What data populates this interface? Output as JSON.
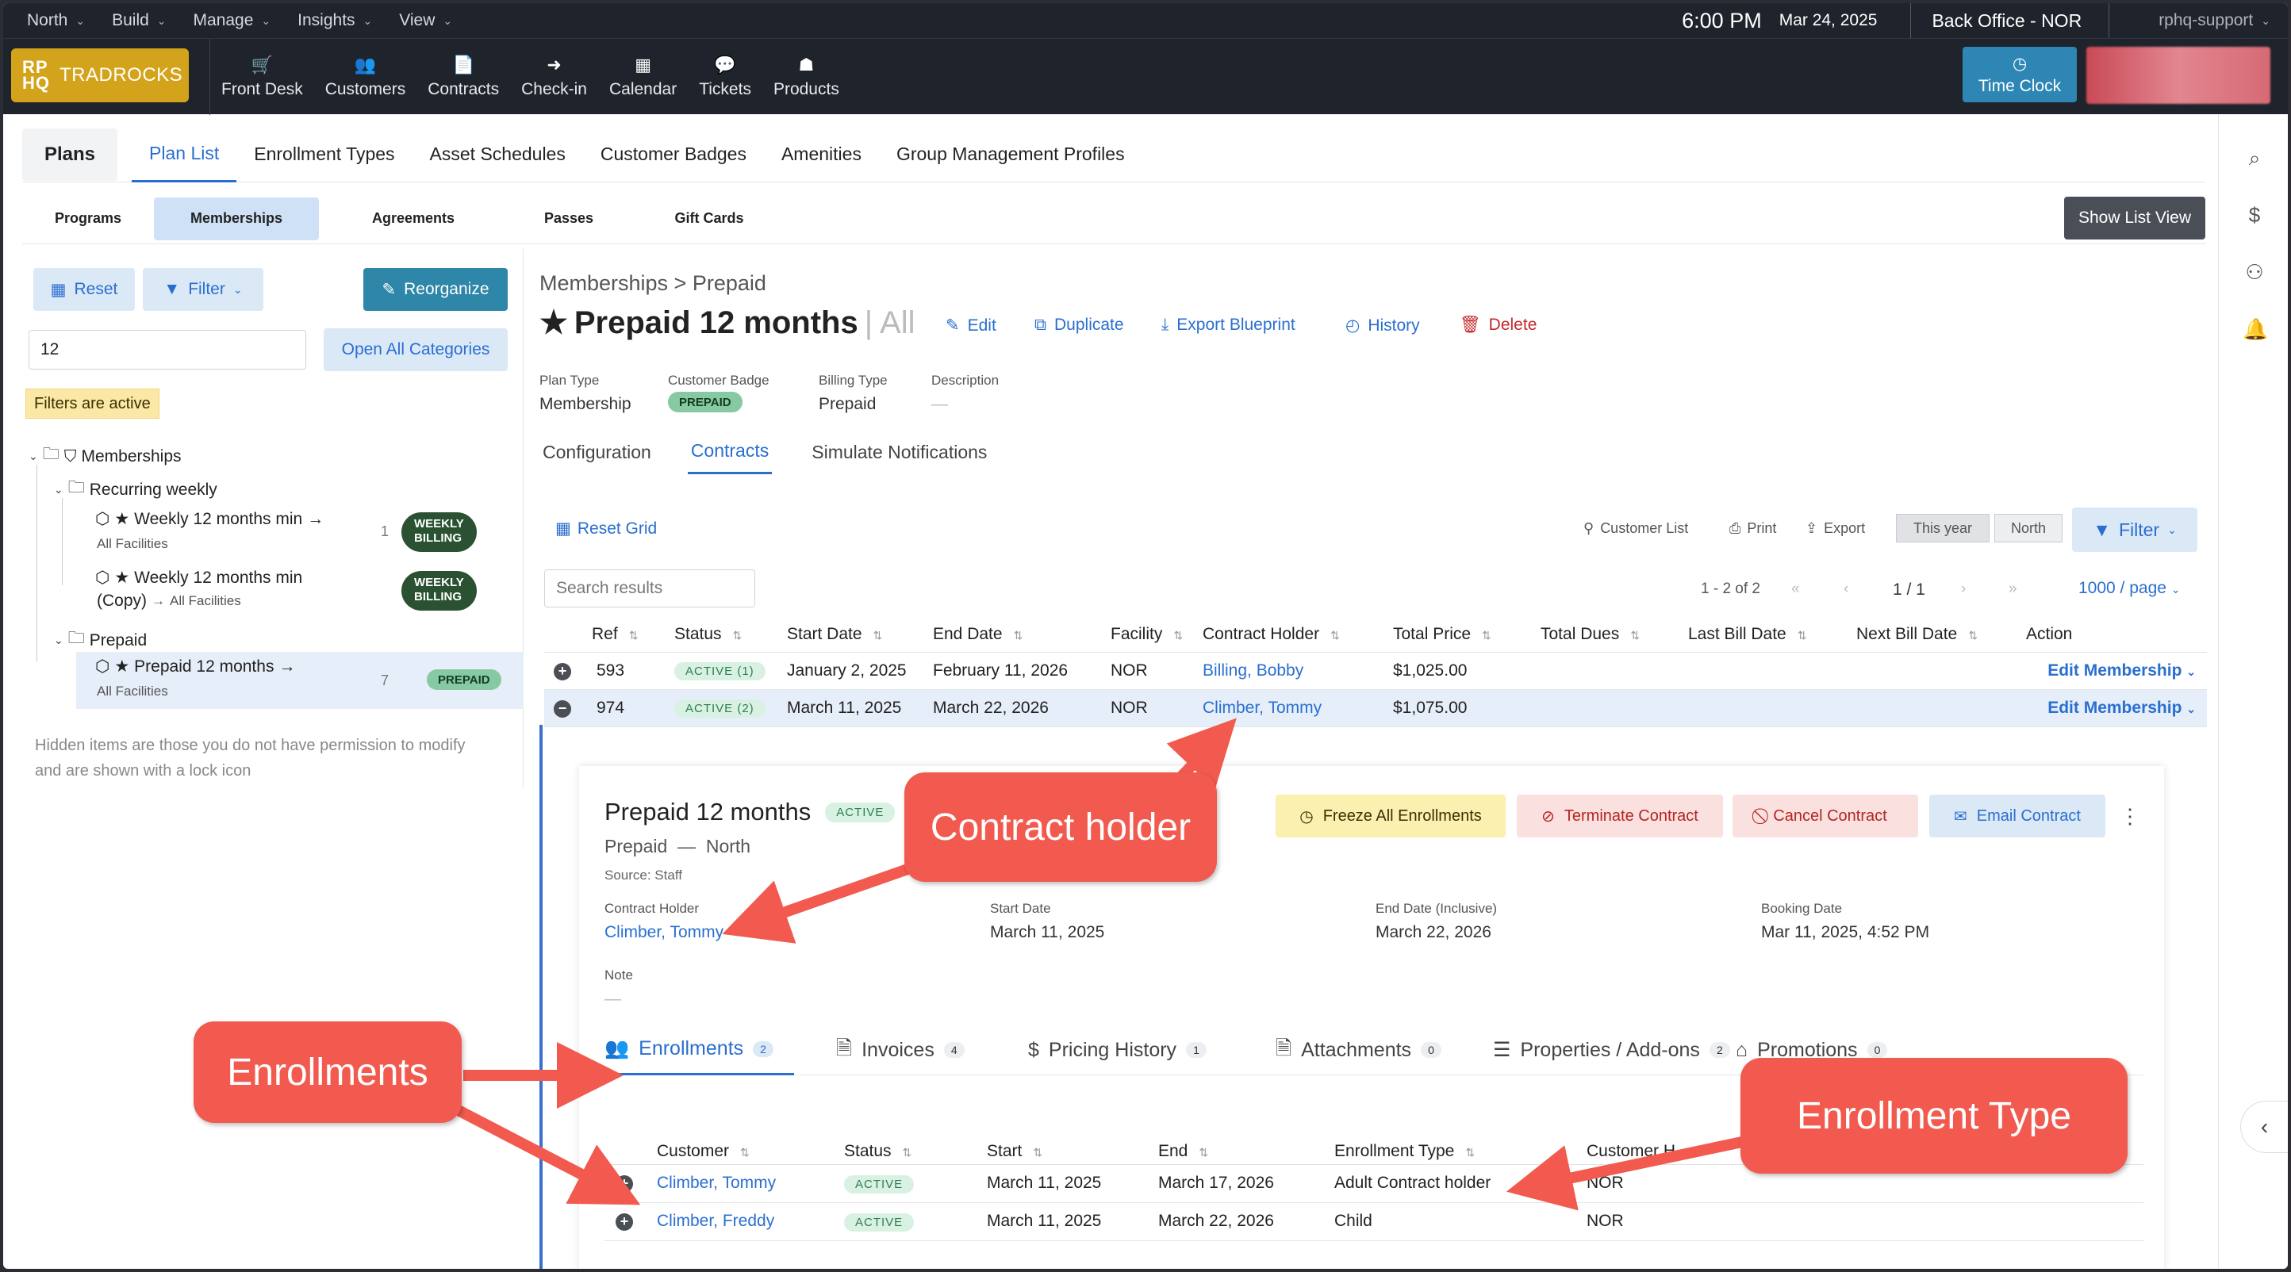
{
  "topbar": {
    "menu": [
      "North",
      "Build",
      "Manage",
      "Insights",
      "View"
    ],
    "time": "6:00 PM",
    "date": "Mar 24, 2025",
    "office": "Back Office - NOR",
    "user": "rphq-support"
  },
  "logo": {
    "mark_line1": "RP",
    "mark_line2": "HQ",
    "name": "TRADROCKS"
  },
  "nav": [
    {
      "label": "Front Desk",
      "icon": "cart-icon"
    },
    {
      "label": "Customers",
      "icon": "users-icon"
    },
    {
      "label": "Contracts",
      "icon": "contract-icon"
    },
    {
      "label": "Check-in",
      "icon": "checkin-icon"
    },
    {
      "label": "Calendar",
      "icon": "calendar-icon"
    },
    {
      "label": "Tickets",
      "icon": "ticket-icon"
    },
    {
      "label": "Products",
      "icon": "products-icon"
    }
  ],
  "timeclock": {
    "label": "Time Clock"
  },
  "main_tabs": {
    "plans": "Plans",
    "items": [
      "Plan List",
      "Enrollment Types",
      "Asset Schedules",
      "Customer Badges",
      "Amenities",
      "Group Management Profiles"
    ]
  },
  "sub_tabs": {
    "items": [
      "Programs",
      "Memberships",
      "Agreements",
      "Passes",
      "Gift Cards"
    ],
    "show_list_view": "Show List View"
  },
  "left": {
    "reset": "Reset",
    "filter": "Filter",
    "reorganize": "Reorganize",
    "search_value": "12",
    "open_all": "Open All Categories",
    "filters_active": "Filters are active",
    "tree_root": "Memberships",
    "cat_recurring": "Recurring weekly",
    "item1_title": "Weekly 12 months min",
    "item1_sub": "All Facilities",
    "item1_count": "1",
    "item2_title": "Weekly 12 months min",
    "item2_copy": "(Copy)",
    "item2_sub": "All Facilities",
    "badge_weekly_1": "WEEKLY",
    "badge_weekly_2": "BILLING",
    "cat_prepaid": "Prepaid",
    "item3_title": "Prepaid 12 months",
    "item3_sub": "All Facilities",
    "item3_count": "7",
    "badge_prepaid": "PREPAID",
    "hidden_note": "Hidden items are those you do not have permission to modify and are shown with a lock icon"
  },
  "header": {
    "breadcrumb": "Memberships > Prepaid",
    "title": "Prepaid 12 months",
    "title_suffix": "| All",
    "actions": {
      "edit": "Edit",
      "duplicate": "Duplicate",
      "export": "Export Blueprint",
      "history": "History",
      "delete": "Delete"
    },
    "meta": [
      {
        "label": "Plan Type",
        "value": "Membership"
      },
      {
        "label": "Customer Badge",
        "value": "PREPAID"
      },
      {
        "label": "Billing Type",
        "value": "Prepaid"
      },
      {
        "label": "Description",
        "value": "—"
      }
    ]
  },
  "content_tabs": [
    "Configuration",
    "Contracts",
    "Simulate Notifications"
  ],
  "grid_toolbar": {
    "reset_grid": "Reset Grid",
    "customer_list": "Customer List",
    "print": "Print",
    "export": "Export",
    "this_year": "This year",
    "north": "North",
    "filter": "Filter",
    "search_placeholder": "Search results",
    "range": "1 - 2 of 2",
    "page": "1 / 1",
    "per_page": "1000 / page"
  },
  "contracts_table": {
    "columns": [
      "Ref",
      "Status",
      "Start Date",
      "End Date",
      "Facility",
      "Contract Holder",
      "Total Price",
      "Total Dues",
      "Last Bill Date",
      "Next Bill Date",
      "Action"
    ],
    "rows": [
      {
        "ref": "593",
        "status": "ACTIVE (1)",
        "start": "January 2, 2025",
        "end": "February 11, 2026",
        "facility": "NOR",
        "holder": "Billing, Bobby",
        "price": "$1,025.00",
        "dues": "",
        "last": "",
        "next": "",
        "action": "Edit Membership"
      },
      {
        "ref": "974",
        "status": "ACTIVE (2)",
        "start": "March 11, 2025",
        "end": "March 22, 2026",
        "facility": "NOR",
        "holder": "Climber, Tommy",
        "price": "$1,075.00",
        "dues": "",
        "last": "",
        "next": "",
        "action": "Edit Membership"
      }
    ]
  },
  "detail": {
    "title": "Prepaid 12 months",
    "status": "ACTIVE",
    "sub_type": "Prepaid",
    "sub_dash": "—",
    "sub_facility": "North",
    "source": "Source: Staff",
    "buttons": {
      "freeze": "Freeze All Enrollments",
      "terminate": "Terminate Contract",
      "cancel": "Cancel Contract",
      "email": "Email Contract"
    },
    "fields": [
      {
        "label": "Contract Holder",
        "value": "Climber, Tommy"
      },
      {
        "label": "Start Date",
        "value": "March 11, 2025"
      },
      {
        "label": "End Date (Inclusive)",
        "value": "March 22, 2026"
      },
      {
        "label": "Booking Date",
        "value": "Mar 11, 2025, 4:52 PM"
      }
    ],
    "note_label": "Note",
    "note_value": "—",
    "tabs": [
      {
        "label": "Enrollments",
        "count": "2"
      },
      {
        "label": "Invoices",
        "count": "4"
      },
      {
        "label": "Pricing History",
        "count": "1"
      },
      {
        "label": "Attachments",
        "count": "0"
      },
      {
        "label": "Properties / Add-ons",
        "count": "2"
      },
      {
        "label": "Promotions",
        "count": "0"
      }
    ]
  },
  "enrollments_table": {
    "columns": [
      "Customer",
      "Status",
      "Start",
      "End",
      "Enrollment Type",
      "Customer H"
    ],
    "rows": [
      {
        "customer": "Climber, Tommy",
        "status": "ACTIVE",
        "start": "March 11, 2025",
        "end": "March 17, 2026",
        "type": "Adult Contract holder",
        "home": "NOR"
      },
      {
        "customer": "Climber, Freddy",
        "status": "ACTIVE",
        "start": "March 11, 2025",
        "end": "March 22, 2026",
        "type": "Child",
        "home": "NOR"
      }
    ]
  },
  "callouts": {
    "contract_holder": "Contract holder",
    "enrollments": "Enrollments",
    "enrollment_type": "Enrollment Type"
  },
  "colors": {
    "accent": "#2a6fd0",
    "logo": "#d4a31c",
    "callout": "#f25a4f",
    "nav_bg": "#1f232b"
  }
}
